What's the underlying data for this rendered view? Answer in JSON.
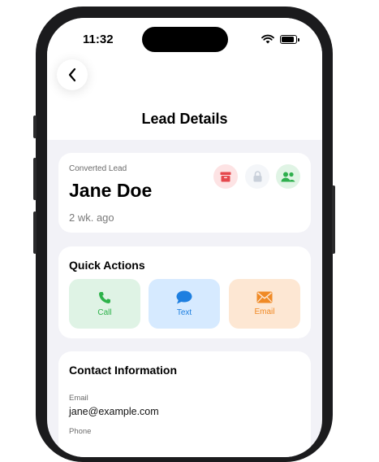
{
  "status_bar": {
    "time": "11:32"
  },
  "header": {
    "title": "Lead Details"
  },
  "lead": {
    "status": "Converted Lead",
    "name": "Jane Doe",
    "time_ago": "2 wk. ago"
  },
  "quick_actions": {
    "title": "Quick Actions",
    "items": [
      {
        "label": "Call",
        "icon": "phone-icon",
        "color": "#2db24a"
      },
      {
        "label": "Text",
        "icon": "chat-bubble-icon",
        "color": "#1e7fe0"
      },
      {
        "label": "Email",
        "icon": "envelope-icon",
        "color": "#f08a26"
      }
    ]
  },
  "contact": {
    "title": "Contact Information",
    "email_label": "Email",
    "email": "jane@example.com",
    "phone_label": "Phone"
  },
  "colors": {
    "archive": "#e5484d",
    "lock": "#c9d0da",
    "people": "#2eaf4d",
    "background": "#f2f2f7"
  }
}
